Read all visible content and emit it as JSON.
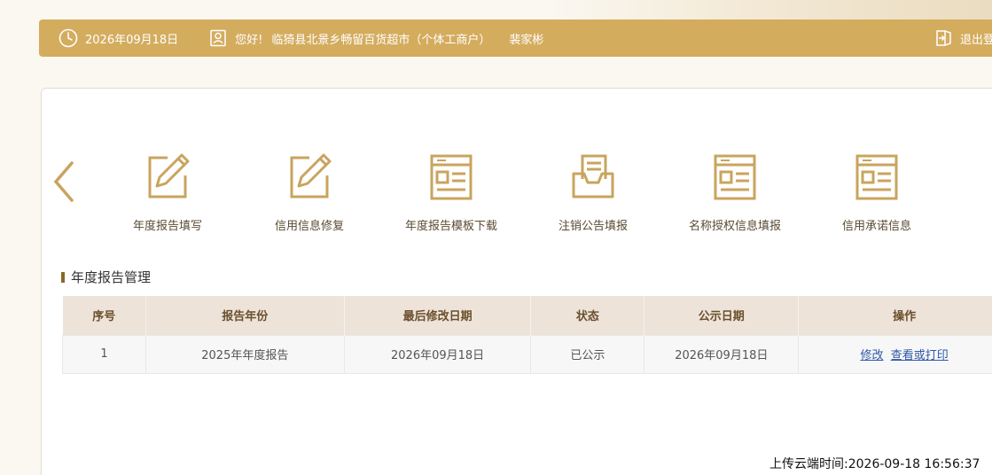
{
  "header": {
    "date": "2026年09月18日",
    "greeting": "您好!",
    "company": "临猗县北景乡畅留百货超市（个体工商户）",
    "person": "裴家彬",
    "logout_label": "退出登录"
  },
  "functions": [
    {
      "label": "年度报告填写",
      "icon": "edit-icon"
    },
    {
      "label": "信用信息修复",
      "icon": "edit-icon"
    },
    {
      "label": "年度报告模板下载",
      "icon": "document-icon"
    },
    {
      "label": "注销公告填报",
      "icon": "inbox-icon"
    },
    {
      "label": "名称授权信息填报",
      "icon": "document-icon"
    },
    {
      "label": "信用承诺信息",
      "icon": "document-icon"
    }
  ],
  "section": {
    "title": "年度报告管理"
  },
  "table": {
    "headers": [
      "序号",
      "报告年份",
      "最后修改日期",
      "状态",
      "公示日期",
      "操作"
    ],
    "rows": [
      {
        "index": "1",
        "year": "2025年年度报告",
        "modified": "2026年09月18日",
        "status": "已公示",
        "publish_date": "2026年09月18日",
        "action_edit": "修改",
        "action_view": "查看或打印"
      }
    ]
  },
  "footer": {
    "upload_time": "上传云端时间:2026-09-18 16:56:37"
  },
  "colors": {
    "header_bg": "#d4ac5e",
    "icon_gold": "#c9a45e",
    "table_header_bg": "#ede3d9",
    "link": "#2f57a6"
  }
}
